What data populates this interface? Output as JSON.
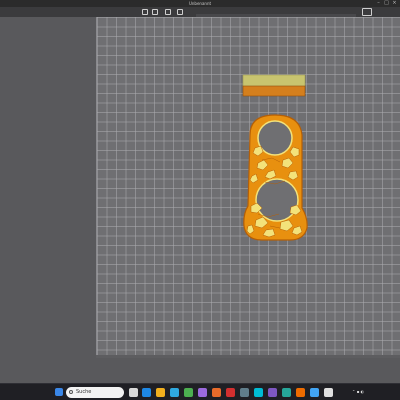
{
  "window": {
    "title": "Unbenannt"
  },
  "taskbar": {
    "search_placeholder": "Suche"
  },
  "colors": {
    "plate": "#6f6f72",
    "grid": "#aaaaaf",
    "part_orange": "#e8900f",
    "part_dark_orange": "#b55f06",
    "infill_yellow": "#f3e27a",
    "bar_top": "#c8c46f",
    "bar_bottom": "#d47f1d",
    "taskbar": "#1f1f24"
  },
  "icons": {
    "toolbar": [
      "cube-view-icon",
      "layers-icon",
      "object-icon",
      "settings-icon"
    ],
    "taskbar": [
      "windows-start-icon",
      "search-icon",
      "explorer-icon",
      "edge-icon",
      "store-icon",
      "mail-icon",
      "slicer-icon",
      "photos-icon",
      "settings-icon"
    ]
  }
}
